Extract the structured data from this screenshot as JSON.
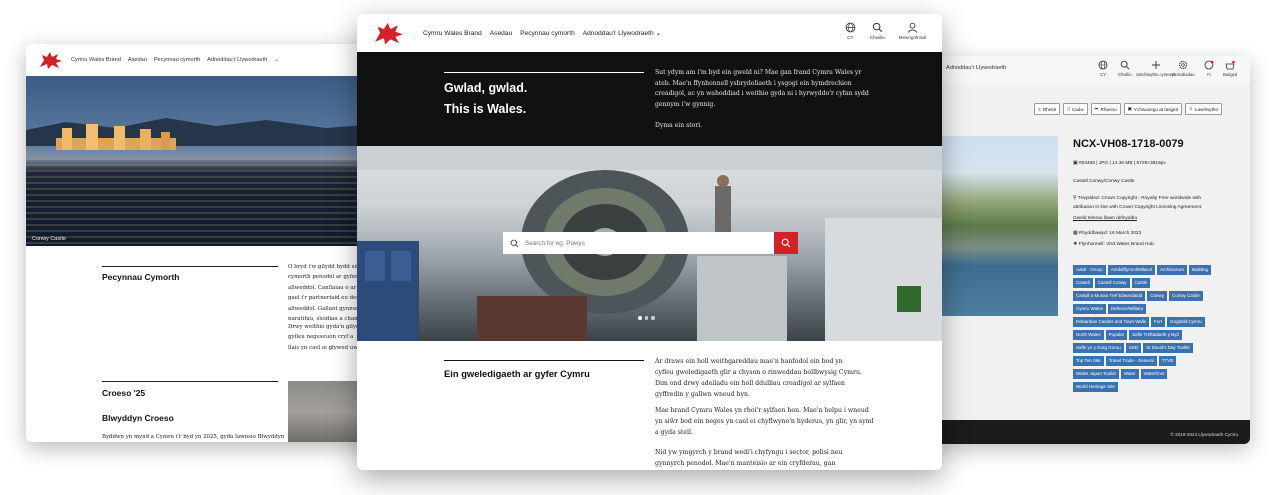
{
  "left_window": {
    "nav": [
      "Cymru Wales Brand",
      "Asedau",
      "Pecynnau cymorth",
      "Adnoddau'r Llywodraeth"
    ],
    "hero_caption": "Conwy Castle",
    "section1_title": "Pecynnau Cymorth",
    "section1_lines": [
      "O bryd i'w gilydd bydd sin",
      "cymorth penodol ar gyfer",
      "allweddol. Canllaiau o ar",
      "gael i'r partneriaid eu defn",
      "allweddol. Gallant gynnwys",
      "naratifau, sleidiau a chanlla"
    ],
    "section1_lines2": [
      "Drwy weithio gyda'n gilydd",
      "gyfleu negeseuon cryf a",
      "llais yn cael ei glywed uwch"
    ],
    "section2_title": "Croeso '25",
    "section2_subtitle": "Blwyddyn Croeso",
    "bottom_text": "Byddwn yn mynd a Cymru i'r byd yn 2025, gyda lawnsio Blwyddyn"
  },
  "center_window": {
    "nav": [
      "Cymru Wales Brand",
      "Asedau",
      "Pecynnau cymorth",
      "Adnoddau'r Llywodraeth"
    ],
    "nav_right": [
      {
        "label": "CY",
        "icon": "globe-icon"
      },
      {
        "label": "Chwilio",
        "icon": "search-icon"
      },
      {
        "label": "Mewngofnodi",
        "icon": "user-icon"
      }
    ],
    "hero_title_line1": "Gwlad, gwlad.",
    "hero_title_line2": "This is Wales.",
    "hero_para": [
      "Sut ydym am i'm byd ein gweld ni? Mae gan frand Cymru Wales yr",
      "ateb. Mae'n ffynhonnell ysbrydoliaeth i ysgogi ein hymdrechion",
      "creadigol, ac yn wahoddiad i weithio gyda ni i hyrwyddo'r cyfan sydd",
      "gennym i'w gynnig."
    ],
    "hero_para2": "Dyma ein stori.",
    "search_placeholder": "Search for eg: Powys",
    "section_title": "Ein gweledigaeth ar gyfer Cymru",
    "body1": [
      "Ar draws ein holl weithgareddau mae'n hanfodol ein bod yn",
      "cyfleu gweledigaeth glir a chyson o rinweddau hollbwysig Cymru.",
      "Dim ond drwy adeiladu ein holl ddulliau creadigol ar sylfaen",
      "gyffredin y gallwn wneud hyn."
    ],
    "body2": [
      "Mae brand Cymru Wales yn rhoi'r sylfaen hon. Mae'n helpu i wneud",
      "yn siŵr bod ein neges yn cael ei chyflwyno'n hyderus, yn glir, yn syml",
      "a gyda steil."
    ],
    "body3": [
      "Nid yw ymgyrch y brand wedi'i chyfyngu i sector, polisi neu",
      "gynnyrch penodol. Mae'n manteisio ar ein cryfderau, gan"
    ]
  },
  "right_window": {
    "nav_fragment": "Adnoddau'r Llywodraeth",
    "nav_icons": [
      {
        "label": "CY",
        "icon": "globe-icon"
      },
      {
        "label": "Chwilio",
        "icon": "search-icon"
      },
      {
        "label": "Uwchlwytho cynnwys",
        "icon": "plus-icon"
      },
      {
        "label": "Gosodiadau",
        "icon": "gear-icon"
      },
      {
        "label": "Fi",
        "icon": "avatar-icon"
      },
      {
        "label": "Basged",
        "icon": "basket-icon"
      }
    ],
    "actions": [
      "Rhestr",
      "Cadw",
      "Rhannu",
      "Ychwanegu at fasged",
      "Lawrlwytho"
    ],
    "asset_title": "NCX-VH08-1718-0079",
    "meta_id": "#53468 | JPG | 14.36 MB | 5729×3819px",
    "meta_name": "Castell Conwy/Conwy Castle",
    "meta_license_line1": "Trwydded: Crown Copyright - Royalty Free worldwide with",
    "meta_license_line2": "attribution in line with Crown Copyright Licensing Agreement.",
    "meta_license_link": "Gweld telerau llawn defnyddio",
    "meta_date": "Rhyddhawyd: 16 March 2023",
    "meta_source": "Ffynhonnell: Visit Wales Brand Hub",
    "tags": [
      "Adult - Group",
      "Amddiffynnol/Milwrol",
      "Architecture",
      "Building",
      "Castell",
      "Castell Conwy",
      "Castle",
      "Castyll a Muriau Tref Edwardaidd",
      "Conwy",
      "Conwy Castle",
      "Cymru Wales",
      "Defence/Military",
      "Edwardian Castles and Town Walls",
      "Fort",
      "Gogledd Cymru",
      "North Wales",
      "Popular",
      "Safle Treftadaeth y Byd",
      "Safle yn y Gorg Goruu",
      "SDD",
      "St David's Day Toolkit",
      "Top Ten Site",
      "Travel Trade - General",
      "TTVB",
      "Wales Japan Toolkit",
      "Water",
      "Waterfront",
      "World Heritage Site"
    ],
    "copyright": "© 2018-2024 Llywodraeth Cymru"
  },
  "colors": {
    "accent_red": "#d42027",
    "tag_blue": "#3a72b0",
    "dark": "#111111"
  }
}
